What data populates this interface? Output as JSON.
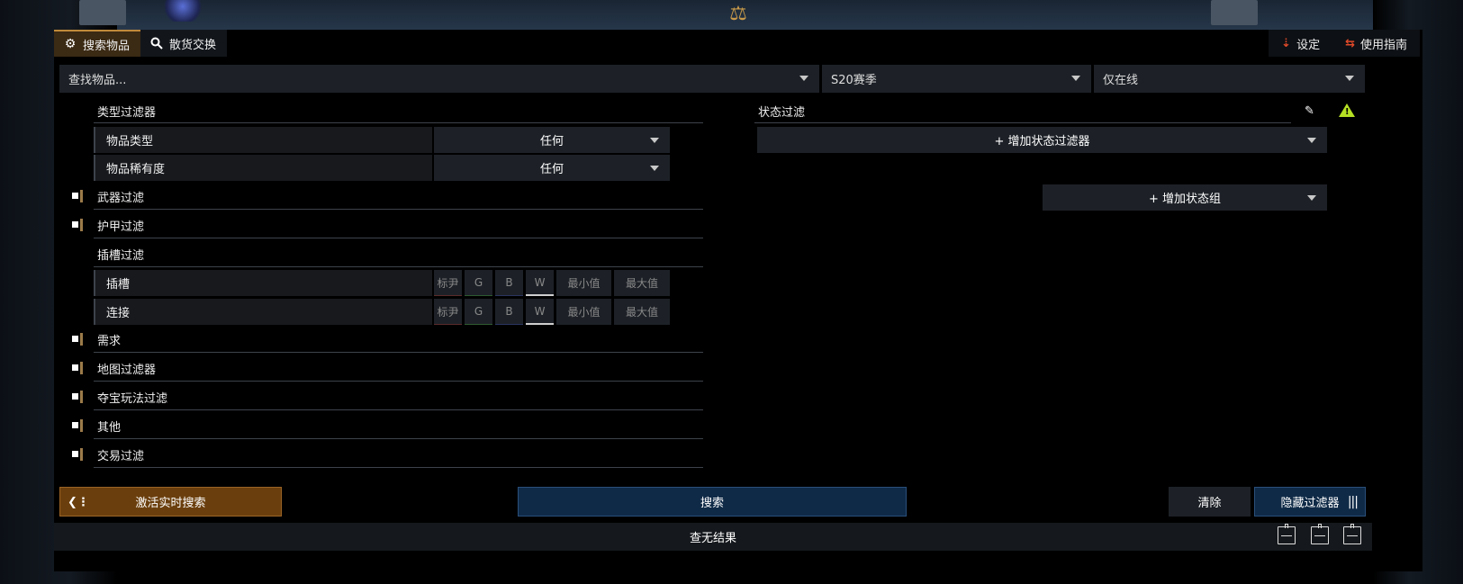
{
  "tabs": [
    {
      "label": "搜索物品",
      "icon": "gear-icon",
      "active": true
    },
    {
      "label": "散货交换",
      "icon": "search-icon",
      "active": false
    }
  ],
  "topright": {
    "settings_label": "设定",
    "guide_label": "使用指南"
  },
  "searchbar": {
    "item_placeholder": "查找物品...",
    "league": "S20赛季",
    "status": "仅在线"
  },
  "type_filters": {
    "title": "类型过滤器",
    "rows": [
      {
        "label": "物品类型",
        "value": "任何"
      },
      {
        "label": "物品稀有度",
        "value": "任何"
      }
    ]
  },
  "filter_groups": {
    "weapon": "武器过滤",
    "armour": "护甲过滤",
    "socket": "插槽过滤"
  },
  "socket_filters": {
    "rows": [
      {
        "label": "插槽"
      },
      {
        "label": "连接"
      }
    ],
    "cols": [
      "标尹",
      "G",
      "B",
      "W",
      "最小值",
      "最大值"
    ]
  },
  "more_groups": [
    "需求",
    "地图过滤器",
    "夺宝玩法过滤",
    "其他",
    "交易过滤"
  ],
  "stat_filters": {
    "title": "状态过滤",
    "add_filter": "+ 增加状态过滤器",
    "add_group": "+ 增加状态组"
  },
  "buttons": {
    "live": "激活实时搜索",
    "search": "搜索",
    "clear": "清除",
    "hide": "隐藏过滤器"
  },
  "footer": {
    "result": "查无结果"
  },
  "colors": {
    "accent_orange": "#6b3f0d",
    "accent_blue": "#0f2a47",
    "warning": "#b6e024"
  }
}
